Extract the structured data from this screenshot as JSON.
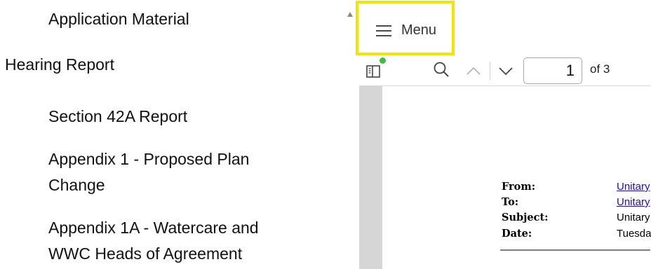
{
  "nav": {
    "application_material": "Application Material",
    "hearing_report": "Hearing Report",
    "section_42a": "Section 42A Report",
    "appendix_1_line1": "Appendix 1 - Proposed Plan",
    "appendix_1_line2": "Change",
    "appendix_1a_line1": "Appendix 1A - Watercare and",
    "appendix_1a_line2": "WWC Heads of Agreement"
  },
  "menu": {
    "label": "Menu",
    "highlight_color": "#f2e600"
  },
  "pdf": {
    "page_current": "1",
    "page_total_text": "of 3",
    "icons": {
      "sidebar": "sidebar-toggle-icon",
      "search": "search-icon",
      "prev": "chevron-up-icon",
      "next": "chevron-down-icon"
    },
    "memo": {
      "from_label": "From:",
      "to_label": "To:",
      "subject_label": "Subject:",
      "date_label": "Date:",
      "from_value": "Unitary",
      "to_value": "Unitary",
      "subject_value": "Unitary",
      "date_value": "Tuesda"
    }
  },
  "colors": {
    "link": "#1a0dce",
    "status_dot": "#3fbf3f",
    "canvas_bg": "#d6d6d6"
  }
}
